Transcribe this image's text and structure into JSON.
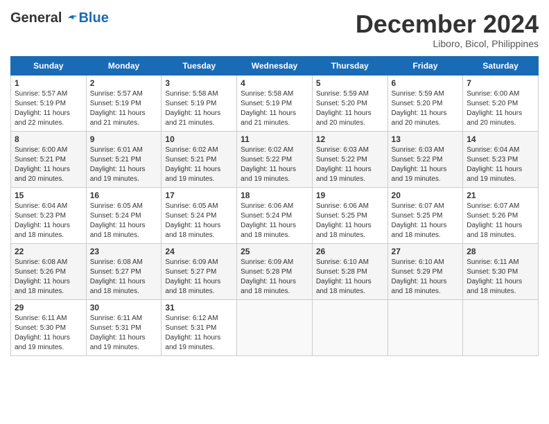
{
  "header": {
    "logo_general": "General",
    "logo_blue": "Blue",
    "month_title": "December 2024",
    "location": "Liboro, Bicol, Philippines"
  },
  "calendar": {
    "days_of_week": [
      "Sunday",
      "Monday",
      "Tuesday",
      "Wednesday",
      "Thursday",
      "Friday",
      "Saturday"
    ],
    "weeks": [
      [
        {
          "day": "",
          "empty": true
        },
        {
          "day": "",
          "empty": true
        },
        {
          "day": "",
          "empty": true
        },
        {
          "day": "",
          "empty": true
        },
        {
          "day": "",
          "empty": true
        },
        {
          "day": "",
          "empty": true
        },
        {
          "day": "",
          "empty": true
        }
      ],
      [
        {
          "num": "1",
          "sunrise": "5:57 AM",
          "sunset": "5:19 PM",
          "daylight": "11 hours and 22 minutes."
        },
        {
          "num": "2",
          "sunrise": "5:57 AM",
          "sunset": "5:19 PM",
          "daylight": "11 hours and 21 minutes."
        },
        {
          "num": "3",
          "sunrise": "5:58 AM",
          "sunset": "5:19 PM",
          "daylight": "11 hours and 21 minutes."
        },
        {
          "num": "4",
          "sunrise": "5:58 AM",
          "sunset": "5:19 PM",
          "daylight": "11 hours and 21 minutes."
        },
        {
          "num": "5",
          "sunrise": "5:59 AM",
          "sunset": "5:20 PM",
          "daylight": "11 hours and 20 minutes."
        },
        {
          "num": "6",
          "sunrise": "5:59 AM",
          "sunset": "5:20 PM",
          "daylight": "11 hours and 20 minutes."
        },
        {
          "num": "7",
          "sunrise": "6:00 AM",
          "sunset": "5:20 PM",
          "daylight": "11 hours and 20 minutes."
        }
      ],
      [
        {
          "num": "8",
          "sunrise": "6:00 AM",
          "sunset": "5:21 PM",
          "daylight": "11 hours and 20 minutes."
        },
        {
          "num": "9",
          "sunrise": "6:01 AM",
          "sunset": "5:21 PM",
          "daylight": "11 hours and 19 minutes."
        },
        {
          "num": "10",
          "sunrise": "6:02 AM",
          "sunset": "5:21 PM",
          "daylight": "11 hours and 19 minutes."
        },
        {
          "num": "11",
          "sunrise": "6:02 AM",
          "sunset": "5:22 PM",
          "daylight": "11 hours and 19 minutes."
        },
        {
          "num": "12",
          "sunrise": "6:03 AM",
          "sunset": "5:22 PM",
          "daylight": "11 hours and 19 minutes."
        },
        {
          "num": "13",
          "sunrise": "6:03 AM",
          "sunset": "5:22 PM",
          "daylight": "11 hours and 19 minutes."
        },
        {
          "num": "14",
          "sunrise": "6:04 AM",
          "sunset": "5:23 PM",
          "daylight": "11 hours and 19 minutes."
        }
      ],
      [
        {
          "num": "15",
          "sunrise": "6:04 AM",
          "sunset": "5:23 PM",
          "daylight": "11 hours and 18 minutes."
        },
        {
          "num": "16",
          "sunrise": "6:05 AM",
          "sunset": "5:24 PM",
          "daylight": "11 hours and 18 minutes."
        },
        {
          "num": "17",
          "sunrise": "6:05 AM",
          "sunset": "5:24 PM",
          "daylight": "11 hours and 18 minutes."
        },
        {
          "num": "18",
          "sunrise": "6:06 AM",
          "sunset": "5:24 PM",
          "daylight": "11 hours and 18 minutes."
        },
        {
          "num": "19",
          "sunrise": "6:06 AM",
          "sunset": "5:25 PM",
          "daylight": "11 hours and 18 minutes."
        },
        {
          "num": "20",
          "sunrise": "6:07 AM",
          "sunset": "5:25 PM",
          "daylight": "11 hours and 18 minutes."
        },
        {
          "num": "21",
          "sunrise": "6:07 AM",
          "sunset": "5:26 PM",
          "daylight": "11 hours and 18 minutes."
        }
      ],
      [
        {
          "num": "22",
          "sunrise": "6:08 AM",
          "sunset": "5:26 PM",
          "daylight": "11 hours and 18 minutes."
        },
        {
          "num": "23",
          "sunrise": "6:08 AM",
          "sunset": "5:27 PM",
          "daylight": "11 hours and 18 minutes."
        },
        {
          "num": "24",
          "sunrise": "6:09 AM",
          "sunset": "5:27 PM",
          "daylight": "11 hours and 18 minutes."
        },
        {
          "num": "25",
          "sunrise": "6:09 AM",
          "sunset": "5:28 PM",
          "daylight": "11 hours and 18 minutes."
        },
        {
          "num": "26",
          "sunrise": "6:10 AM",
          "sunset": "5:28 PM",
          "daylight": "11 hours and 18 minutes."
        },
        {
          "num": "27",
          "sunrise": "6:10 AM",
          "sunset": "5:29 PM",
          "daylight": "11 hours and 18 minutes."
        },
        {
          "num": "28",
          "sunrise": "6:11 AM",
          "sunset": "5:30 PM",
          "daylight": "11 hours and 18 minutes."
        }
      ],
      [
        {
          "num": "29",
          "sunrise": "6:11 AM",
          "sunset": "5:30 PM",
          "daylight": "11 hours and 19 minutes."
        },
        {
          "num": "30",
          "sunrise": "6:11 AM",
          "sunset": "5:31 PM",
          "daylight": "11 hours and 19 minutes."
        },
        {
          "num": "31",
          "sunrise": "6:12 AM",
          "sunset": "5:31 PM",
          "daylight": "11 hours and 19 minutes."
        },
        {
          "day": "",
          "empty": true
        },
        {
          "day": "",
          "empty": true
        },
        {
          "day": "",
          "empty": true
        },
        {
          "day": "",
          "empty": true
        }
      ]
    ]
  }
}
